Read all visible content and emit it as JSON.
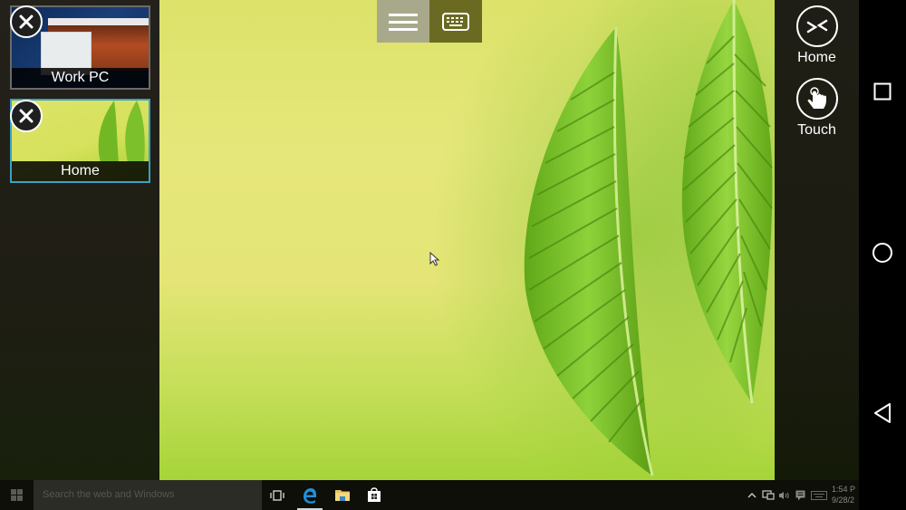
{
  "app": {
    "accent_color": "#3ba0c8"
  },
  "sessions": [
    {
      "label": "Work PC",
      "active": false,
      "close_icon": "close-icon"
    },
    {
      "label": "Home",
      "active": true,
      "close_icon": "close-icon"
    }
  ],
  "toolbar": {
    "menu_icon": "hamburger-menu-icon",
    "keyboard_icon": "keyboard-icon"
  },
  "right_panel": {
    "buttons": [
      {
        "label": "Home",
        "icon": "remote-desktop-icon"
      },
      {
        "label": "Touch",
        "icon": "touch-hand-icon"
      }
    ]
  },
  "android_nav": {
    "buttons": [
      "recents-square-icon",
      "home-circle-icon",
      "back-triangle-icon"
    ]
  },
  "taskbar": {
    "search_placeholder": "Search the web and Windows",
    "pinned": [
      {
        "name": "task-view",
        "icon": "task-view-icon"
      },
      {
        "name": "edge",
        "icon": "edge-icon",
        "active": true
      },
      {
        "name": "file-explorer",
        "icon": "folder-icon"
      },
      {
        "name": "store",
        "icon": "store-bag-icon"
      }
    ],
    "tray": [
      "chevron-up-icon",
      "network-icon",
      "volume-icon",
      "action-center-icon",
      "keyboard-icon"
    ],
    "clock": {
      "time": "1:54 P",
      "date": "9/28/2"
    }
  }
}
